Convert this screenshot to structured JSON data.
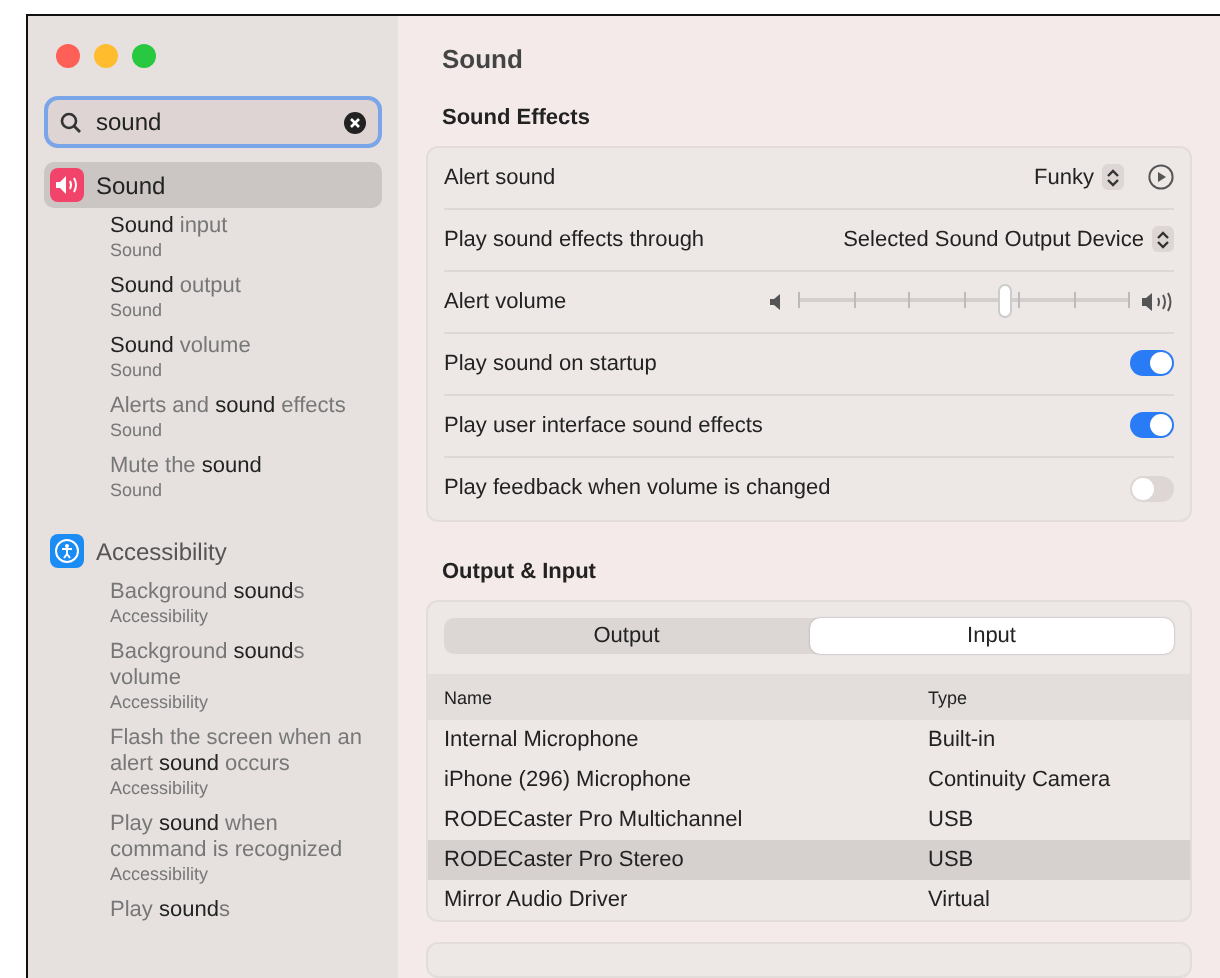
{
  "window": {
    "title": "Sound"
  },
  "search": {
    "value": "sound"
  },
  "sidebar": {
    "groups": [
      {
        "title": "Sound",
        "kind": "sound",
        "selected": true,
        "items": [
          {
            "title": "**Sound** input",
            "subtitle": "Sound"
          },
          {
            "title": "**Sound** output",
            "subtitle": "Sound"
          },
          {
            "title": "**Sound** volume",
            "subtitle": "Sound"
          },
          {
            "title": "Alerts and **sound** effects",
            "subtitle": "Sound"
          },
          {
            "title": "Mute the **sound**",
            "subtitle": "Sound"
          }
        ]
      },
      {
        "title": "Accessibility",
        "kind": "accessibility",
        "selected": false,
        "items": [
          {
            "title": "Background **sound**s",
            "subtitle": "Accessibility"
          },
          {
            "title": "Background **sound**s volume",
            "subtitle": "Accessibility"
          },
          {
            "title": "Flash the screen when an alert **sound** occurs",
            "subtitle": "Accessibility"
          },
          {
            "title": "Play **sound** when command is recognized",
            "subtitle": "Accessibility"
          },
          {
            "title": "Play **sound**s"
          }
        ]
      }
    ]
  },
  "sound_effects": {
    "heading": "Sound Effects",
    "rows": [
      {
        "kind": "popup",
        "label": "Alert sound",
        "value": "Funky",
        "play": true
      },
      {
        "kind": "popup",
        "label": "Play sound effects through",
        "value": "Selected Sound Output Device"
      },
      {
        "kind": "slider",
        "label": "Alert volume",
        "level": 0.64
      },
      {
        "kind": "toggle",
        "label": "Play sound on startup",
        "on": true
      },
      {
        "kind": "toggle",
        "label": "Play user interface sound effects",
        "on": true
      },
      {
        "kind": "toggle",
        "label": "Play feedback when volume is changed",
        "on": false
      }
    ]
  },
  "output_input": {
    "heading": "Output & Input",
    "tabs": [
      {
        "label": "Output",
        "selected": false
      },
      {
        "label": "Input",
        "selected": true
      }
    ],
    "columns": [
      "Name",
      "Type"
    ],
    "rows": [
      {
        "name": "Internal Microphone",
        "type": "Built-in",
        "selected": false
      },
      {
        "name": "iPhone (296) Microphone",
        "type": "Continuity Camera",
        "selected": false
      },
      {
        "name": "RODECaster Pro Multichannel",
        "type": "USB",
        "selected": false
      },
      {
        "name": "RODECaster Pro Stereo",
        "type": "USB",
        "selected": true
      },
      {
        "name": "Mirror Audio Driver",
        "type": "Virtual",
        "selected": false
      }
    ]
  }
}
